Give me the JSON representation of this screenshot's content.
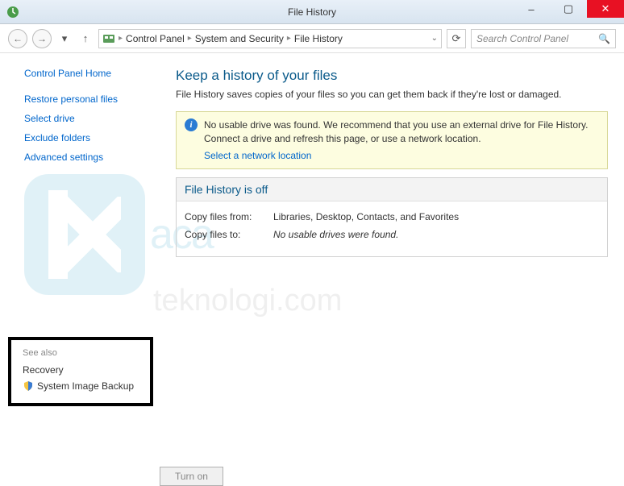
{
  "window": {
    "title": "File History",
    "minimize": "–",
    "maximize": "▢",
    "close": "✕"
  },
  "nav": {
    "back": "←",
    "forward": "→",
    "up": "↑",
    "refresh": "⟳",
    "search_placeholder": "Search Control Panel",
    "breadcrumb": {
      "root": "Control Panel",
      "level2": "System and Security",
      "level3": "File History"
    }
  },
  "sidebar": {
    "home": "Control Panel Home",
    "links": [
      "Restore personal files",
      "Select drive",
      "Exclude folders",
      "Advanced settings"
    ],
    "see_also_title": "See also",
    "see_also": [
      "Recovery",
      "System Image Backup"
    ]
  },
  "main": {
    "heading": "Keep a history of your files",
    "sub": "File History saves copies of your files so you can get them back if they're lost or damaged.",
    "banner": {
      "line1": "No usable drive was found. We recommend that you use an external drive for File History. Connect a drive and refresh this page, or use a network location.",
      "link": "Select a network location"
    },
    "status": {
      "header": "File History is off",
      "copy_from_label": "Copy files from:",
      "copy_from_value": "Libraries, Desktop, Contacts, and Favorites",
      "copy_to_label": "Copy files to:",
      "copy_to_value": "No usable drives were found."
    },
    "turn_on": "Turn on"
  }
}
